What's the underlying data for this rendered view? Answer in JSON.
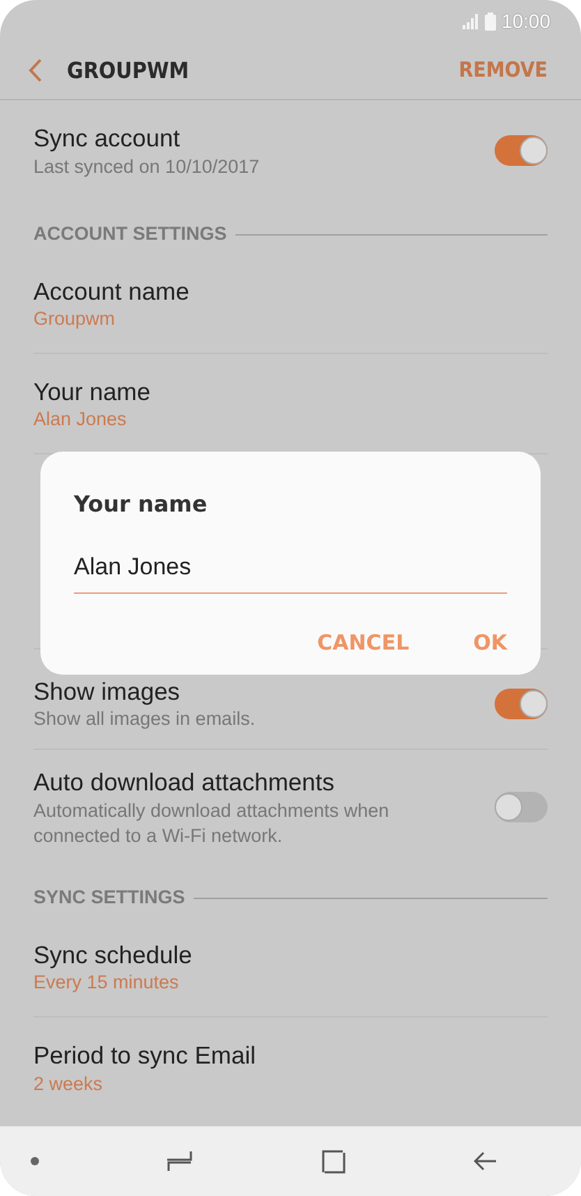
{
  "status_bar": {
    "time": "10:00"
  },
  "header": {
    "title": "GROUPWM",
    "action": "REMOVE"
  },
  "items": [
    {
      "kind": "toggle",
      "title": "Sync account",
      "subtitle": "Last synced on 10/10/2017",
      "on": true
    },
    {
      "kind": "section",
      "title": "ACCOUNT SETTINGS"
    },
    {
      "kind": "value",
      "title": "Account name",
      "subtitle": "Groupwm"
    },
    {
      "kind": "value",
      "title": "Your name",
      "subtitle": "Alan Jones"
    },
    {
      "kind": "toggle",
      "title": "Show images",
      "subtitle": "Show all images in emails.",
      "on": true
    },
    {
      "kind": "toggle",
      "title": "Auto download attachments",
      "subtitle": "Automatically download attachments when connected to a Wi-Fi network.",
      "on": false
    },
    {
      "kind": "section",
      "title": "SYNC SETTINGS"
    },
    {
      "kind": "value",
      "title": "Sync schedule",
      "subtitle": "Every 15 minutes"
    },
    {
      "kind": "value",
      "title": "Period to sync Email",
      "subtitle": "2 weeks"
    }
  ],
  "dialog": {
    "title": "Your name",
    "value": "Alan Jones",
    "buttons": [
      "CANCEL",
      "OK"
    ]
  }
}
